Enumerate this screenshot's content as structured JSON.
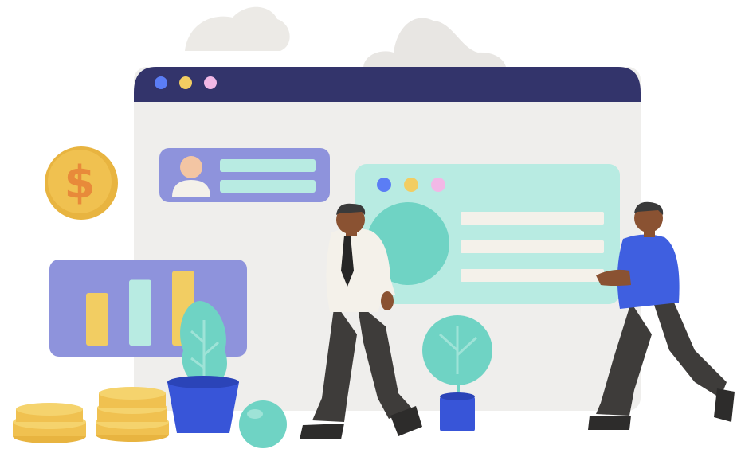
{
  "illustration": {
    "coin": {
      "symbol": "$"
    },
    "colors": {
      "window_bar": "#33346b",
      "window_body": "#efeeec",
      "dot_blue": "#5b7df5",
      "dot_yellow": "#f2cd62",
      "dot_pink": "#f2b8e6",
      "card_lavender": "#8e93dc",
      "panel_mint": "#b8ebe2",
      "teal": "#6fd3c4",
      "coin_gold": "#f0c150",
      "coin_orange": "#e88a3a",
      "shirt_white": "#f4f1ea",
      "shirt_blue": "#3f5fe0",
      "pants_dark": "#3e3c3a",
      "skin": "#8a5232",
      "pot_blue": "#3855d8"
    },
    "chart_bars": [
      0.6,
      0.75,
      0.85
    ]
  }
}
